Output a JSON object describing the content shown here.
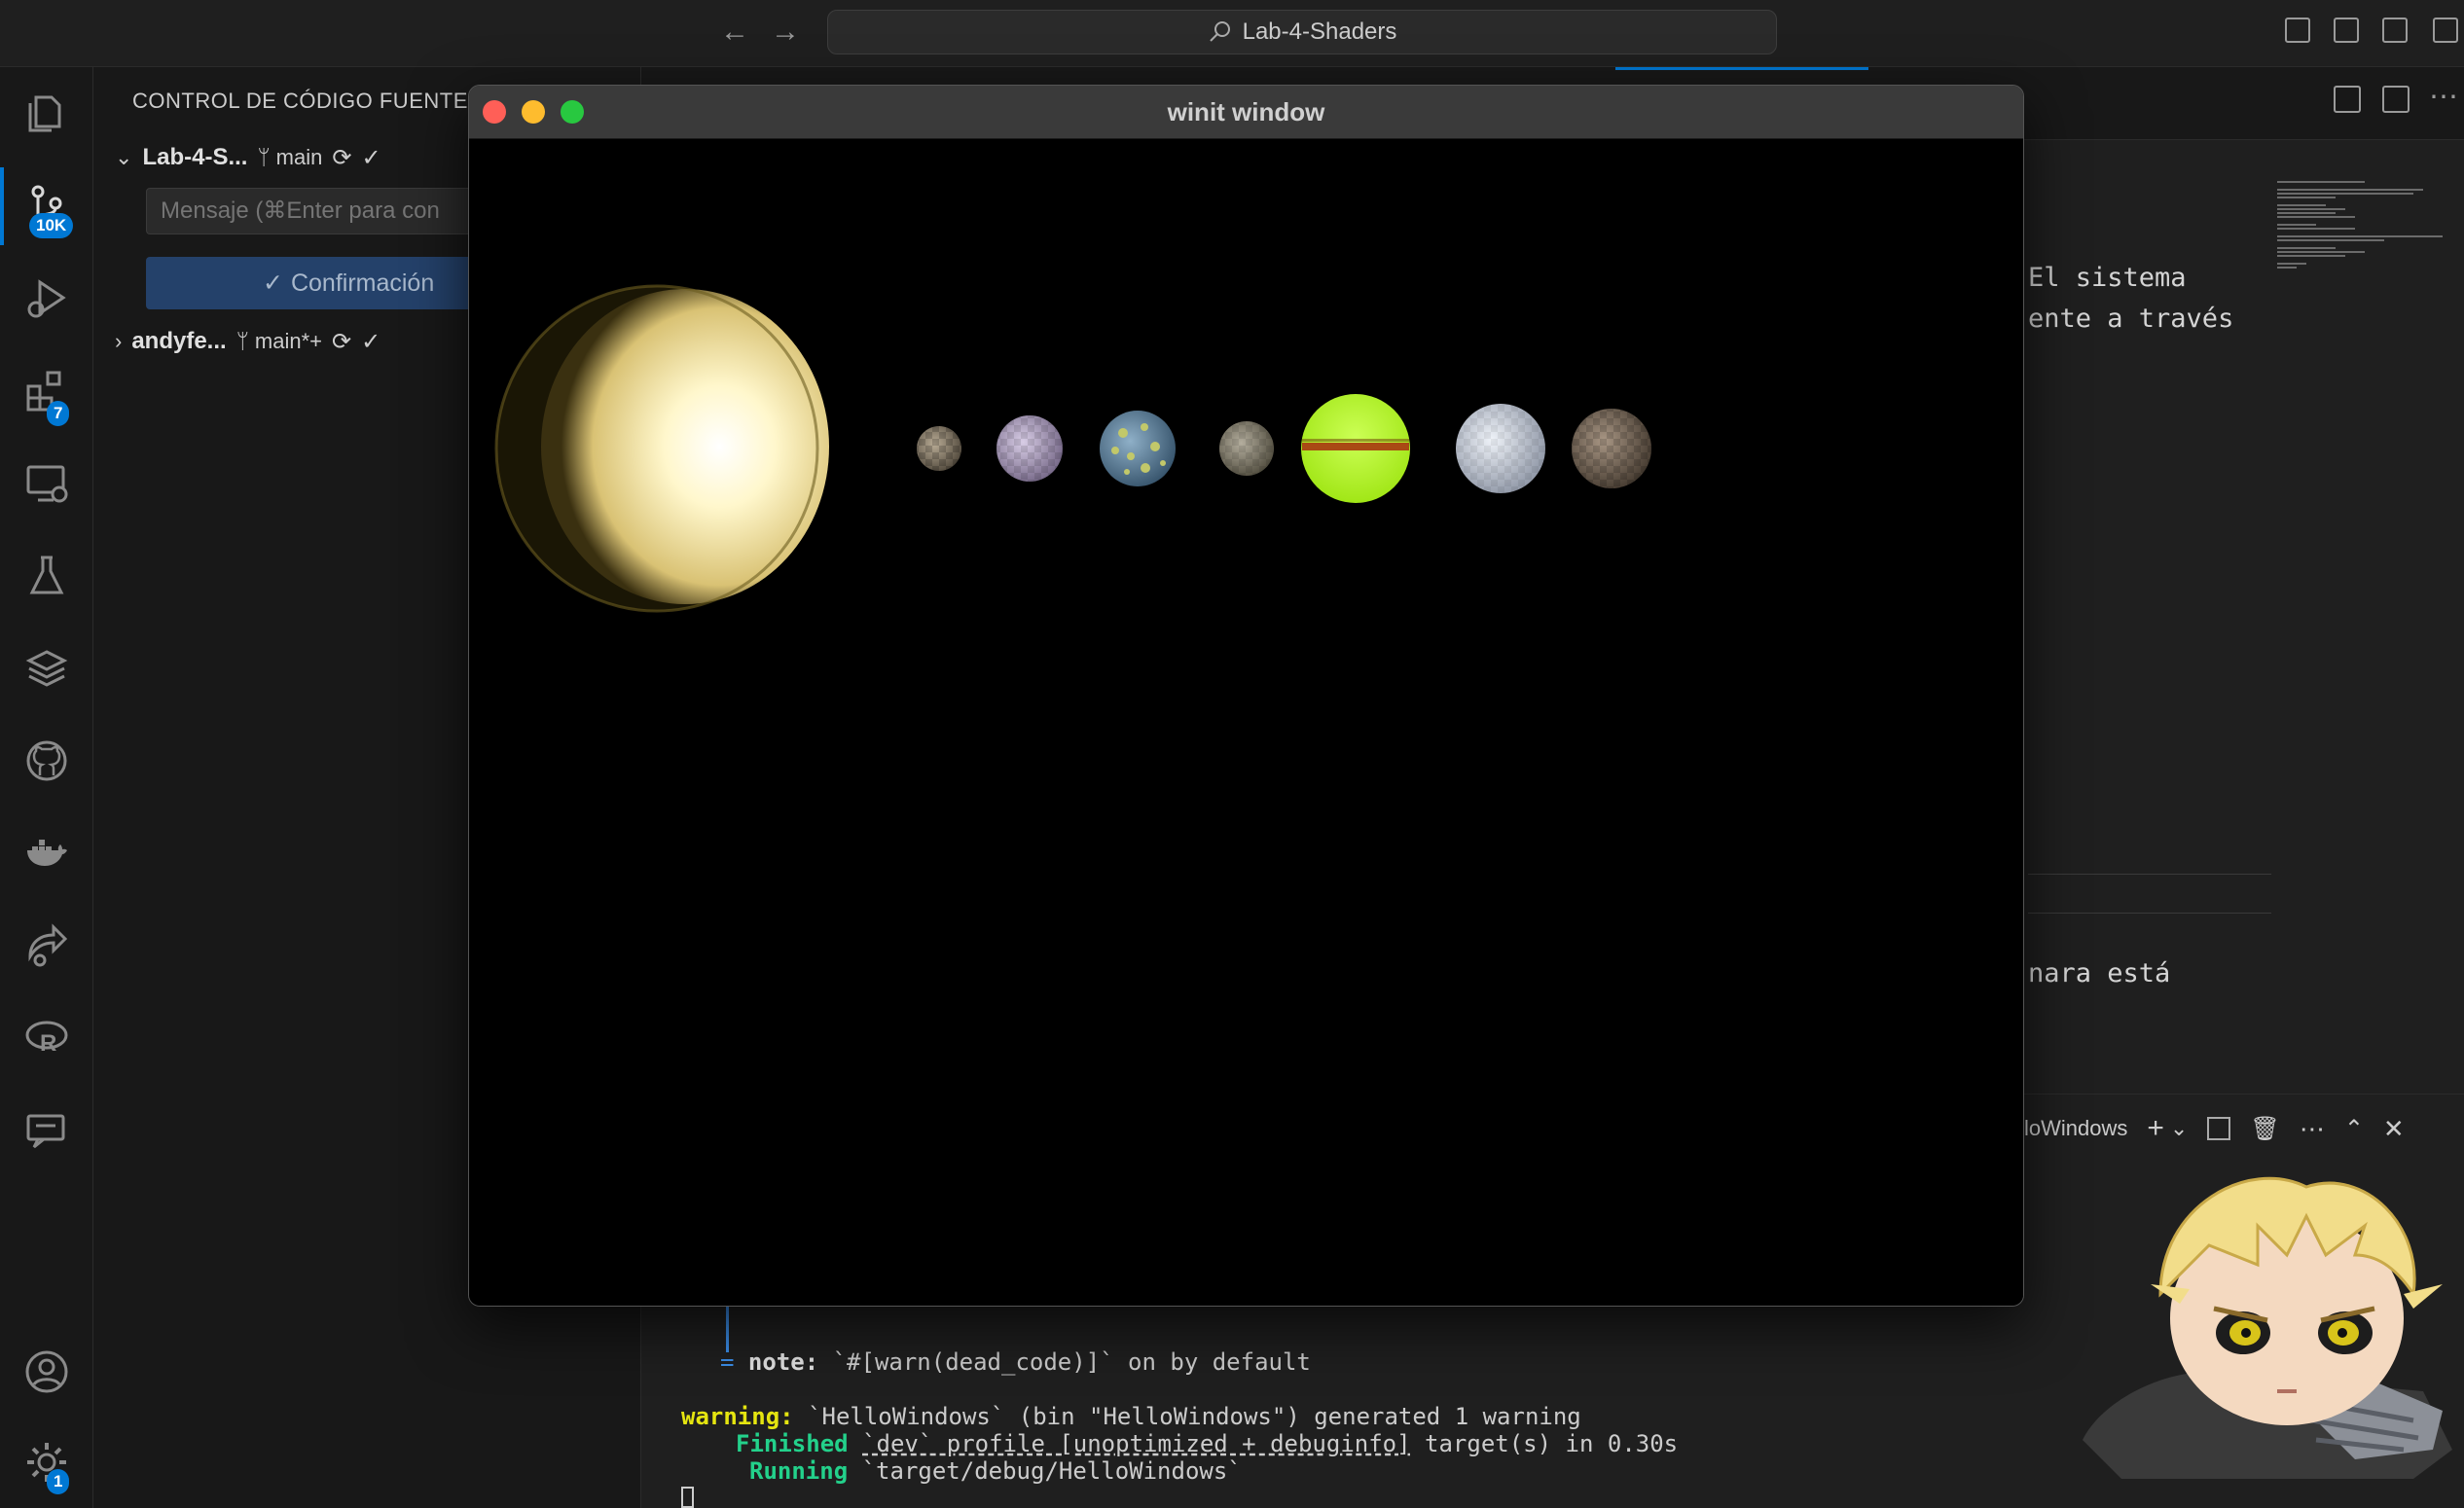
{
  "titlebar": {
    "search_text": "Lab-4-Shaders",
    "back_icon": "arrow-left-icon",
    "forward_icon": "arrow-right-icon"
  },
  "activity_bar": {
    "items": [
      {
        "name": "explorer",
        "icon": "files-icon"
      },
      {
        "name": "source-control",
        "icon": "source-control-icon",
        "badge": "10K"
      },
      {
        "name": "run-debug",
        "icon": "run-debug-icon"
      },
      {
        "name": "extensions",
        "icon": "extensions-icon",
        "badge": "7"
      },
      {
        "name": "remote-explorer",
        "icon": "remote-explorer-icon"
      },
      {
        "name": "testing",
        "icon": "flask-icon"
      },
      {
        "name": "layers",
        "icon": "layers-icon"
      },
      {
        "name": "github",
        "icon": "github-icon"
      },
      {
        "name": "docker",
        "icon": "docker-icon"
      },
      {
        "name": "live-share",
        "icon": "share-icon"
      },
      {
        "name": "r-language",
        "icon": "r-icon"
      },
      {
        "name": "chat",
        "icon": "chat-icon"
      }
    ],
    "bottom": [
      {
        "name": "accounts",
        "icon": "account-icon"
      },
      {
        "name": "manage",
        "icon": "gear-icon",
        "badge": "1"
      }
    ],
    "accent": "#0078d4"
  },
  "sidebar": {
    "title": "CONTROL DE CÓDIGO FUENTE",
    "repos": [
      {
        "name": "Lab-4-S...",
        "branch": "main"
      },
      {
        "name": "andyfe...",
        "branch": "main*+"
      }
    ],
    "message_placeholder": "Mensaje (⌘Enter para con",
    "commit_label": "Confirmación"
  },
  "editor": {
    "visible_text": [
      "El sistema",
      "ente a través",
      "nara está"
    ]
  },
  "panel": {
    "terminal_name": "loWindows"
  },
  "terminal": {
    "note_label": "note:",
    "note_text": " `#[warn(dead_code)]` on by default",
    "warning_label": "warning:",
    "warning_text": " `HelloWindows` (bin \"HelloWindows\") generated 1 warning",
    "finished_label": "Finished",
    "finished_profile": "`dev` profile [unoptimized + debuginfo]",
    "finished_text": " target(s) in 0.30s",
    "running_label": "Running",
    "running_text": " `target/debug/HelloWindows`",
    "colors": {
      "warning": "#e5e510",
      "finished": "#23d18b",
      "note": "#3b8eea"
    }
  },
  "winit_window": {
    "title": "winit window",
    "bodies": [
      {
        "name": "sun",
        "color": "#fff6c8"
      },
      {
        "name": "planet-1",
        "color": "#8a8070"
      },
      {
        "name": "planet-2",
        "color": "#a89ab8"
      },
      {
        "name": "planet-3",
        "color": "#5a80a0"
      },
      {
        "name": "planet-4",
        "color": "#8a8474"
      },
      {
        "name": "planet-5",
        "color": "#b6ff30"
      },
      {
        "name": "planet-6",
        "color": "#c8cfdc"
      },
      {
        "name": "planet-7",
        "color": "#7a6a5a"
      }
    ]
  }
}
